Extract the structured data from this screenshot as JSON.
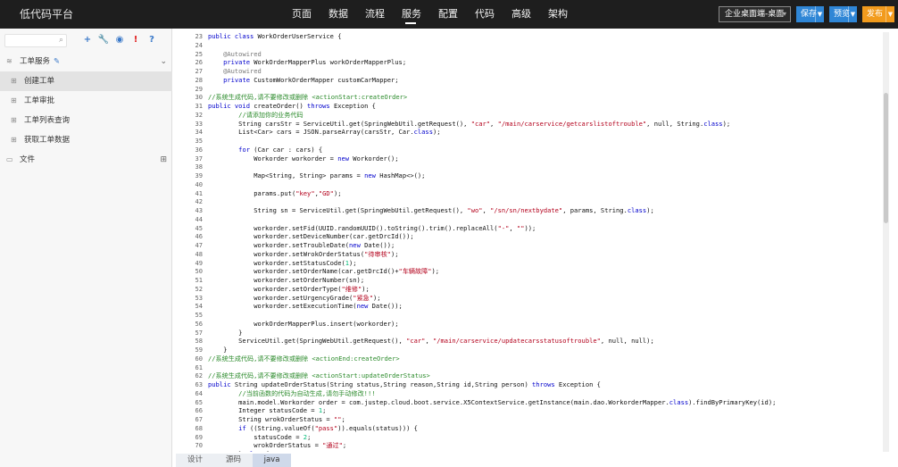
{
  "header": {
    "brand": "低代码平台",
    "nav": [
      "页面",
      "数据",
      "流程",
      "服务",
      "配置",
      "代码",
      "高级",
      "架构"
    ],
    "active_nav": 3,
    "app_select": "企业桌面端-桌面",
    "buttons": [
      {
        "label": "保存",
        "color": "#2f86d6"
      },
      {
        "label": "预览",
        "color": "#2f86d6"
      },
      {
        "label": "发布",
        "color": "#f29b1d"
      }
    ]
  },
  "sidebar": {
    "search_placeholder": "",
    "tools": [
      {
        "icon": "plus-icon",
        "glyph": "+",
        "color": "#3a79c9"
      },
      {
        "icon": "wrench-icon",
        "glyph": "🔧",
        "color": "#3a79c9"
      },
      {
        "icon": "globe-icon",
        "glyph": "◉",
        "color": "#3a79c9"
      },
      {
        "icon": "alert-icon",
        "glyph": "!",
        "color": "#e02020"
      },
      {
        "icon": "help-icon",
        "glyph": "?",
        "color": "#3a79c9"
      }
    ],
    "tree": [
      {
        "label": "工单服务",
        "icon": "layers-icon",
        "glyph": "≋",
        "edit_icon": "✎",
        "expanded": true,
        "children": [
          {
            "label": "创建工单",
            "selected": true
          },
          {
            "label": "工单审批"
          },
          {
            "label": "工单列表查询"
          },
          {
            "label": "获取工单数据"
          }
        ]
      },
      {
        "label": "文件",
        "icon": "folder-icon",
        "glyph": "▭"
      }
    ]
  },
  "editor": {
    "lines": [
      {
        "n": "23",
        "c": "<kw>public class</kw> WorkOrderUserService {"
      },
      {
        "n": "24",
        "c": ""
      },
      {
        "n": "25",
        "c": "    <an>@Autowired</an>"
      },
      {
        "n": "26",
        "c": "    <kw>private</kw> WorkOrderMapperPlus workOrderMapperPlus;"
      },
      {
        "n": "27",
        "c": "    <an>@Autowired</an>"
      },
      {
        "n": "28",
        "c": "    <kw>private</kw> CustomWorkOrderMapper customCarMapper;"
      },
      {
        "n": "29",
        "c": ""
      },
      {
        "n": "30",
        "c": "<cm>//系统生成代码,请不要修改或删除 <actionStart:createOrder></cm>"
      },
      {
        "n": "31",
        "c": "<kw>public void</kw> createOrder() <kw>throws</kw> Exception {"
      },
      {
        "n": "32",
        "c": "        <cm>//请添加你的业务代码</cm>"
      },
      {
        "n": "33",
        "c": "        String carsStr = ServiceUtil.get(SpringWebUtil.getRequest(), <str>\"car\"</str>, <str>\"/main/carservice/getcarslistoftrouble\"</str>, null, String.<kw>class</kw>);"
      },
      {
        "n": "34",
        "c": "        List<Car> cars = JSON.parseArray(carsStr, Car.<kw>class</kw>);"
      },
      {
        "n": "35",
        "c": ""
      },
      {
        "n": "36",
        "c": "        <kw>for</kw> (Car car : cars) {"
      },
      {
        "n": "37",
        "c": "            Workorder workorder = <kw>new</kw> Workorder();"
      },
      {
        "n": "38",
        "c": ""
      },
      {
        "n": "39",
        "c": "            Map<String, String> params = <kw>new</kw> HashMap<>();"
      },
      {
        "n": "40",
        "c": ""
      },
      {
        "n": "41",
        "c": "            params.put(<str>\"key\"</str>,<str>\"GD\"</str>);"
      },
      {
        "n": "42",
        "c": ""
      },
      {
        "n": "43",
        "c": "            String sn = ServiceUtil.get(SpringWebUtil.getRequest(), <str>\"wo\"</str>, <str>\"/sn/sn/nextbydate\"</str>, params, String.<kw>class</kw>);"
      },
      {
        "n": "44",
        "c": ""
      },
      {
        "n": "45",
        "c": "            workorder.setFid(UUID.randomUUID().toString().trim().replaceAll(<str>\"-\"</str>, <str>\"\"</str>));"
      },
      {
        "n": "46",
        "c": "            workorder.setDeviceNumber(car.getDrcId());"
      },
      {
        "n": "47",
        "c": "            workorder.setTroubleDate(<kw>new</kw> Date());"
      },
      {
        "n": "48",
        "c": "            workorder.setWrokOrderStatus(<str>\"待审核\"</str>);"
      },
      {
        "n": "49",
        "c": "            workorder.setStatusCode(<num>1</num>);"
      },
      {
        "n": "50",
        "c": "            workorder.setOrderName(car.getDrcId()+<str>\"车辆故障\"</str>);"
      },
      {
        "n": "51",
        "c": "            workorder.setOrderNumber(sn);"
      },
      {
        "n": "52",
        "c": "            workorder.setOrderType(<str>\"维修\"</str>);"
      },
      {
        "n": "53",
        "c": "            workorder.setUrgencyGrade(<str>\"紧急\"</str>);"
      },
      {
        "n": "54",
        "c": "            workorder.setExecutionTime(<kw>new</kw> Date());"
      },
      {
        "n": "55",
        "c": ""
      },
      {
        "n": "56",
        "c": "            workOrderMapperPlus.insert(workorder);"
      },
      {
        "n": "57",
        "c": "        }"
      },
      {
        "n": "58",
        "c": "        ServiceUtil.get(SpringWebUtil.getRequest(), <str>\"car\"</str>, <str>\"/main/carservice/updatecarsstatusoftrouble\"</str>, null, null);"
      },
      {
        "n": "59",
        "c": "    }"
      },
      {
        "n": "60",
        "c": "<cm>//系统生成代码,请不要修改或删除 <actionEnd:createOrder></cm>"
      },
      {
        "n": "61",
        "c": ""
      },
      {
        "n": "62",
        "c": "<cm>//系统生成代码,请不要修改或删除 <actionStart:updateOrderStatus></cm>"
      },
      {
        "n": "63",
        "c": "<kw>public</kw> String updateOrderStatus(String status,String reason,String id,String person) <kw>throws</kw> Exception {"
      },
      {
        "n": "64",
        "c": "        <cm>//当前函数的代码为自动生成,请勿手动修改!!!</cm>"
      },
      {
        "n": "65",
        "c": "        main.model.Workorder order = com.justep.cloud.boot.service.X5ContextService.getInstance(main.dao.WorkorderMapper.<kw>class</kw>).findByPrimaryKey(id);"
      },
      {
        "n": "66",
        "c": "        Integer statusCode = <num>1</num>;"
      },
      {
        "n": "67",
        "c": "        String wrokOrderStatus = <str>\"\"</str>;"
      },
      {
        "n": "68",
        "c": "        <kw>if</kw> ((String.valueOf(<str>\"pass\"</str>)).equals(status))) {"
      },
      {
        "n": "69",
        "c": "            statusCode = <num>2</num>;"
      },
      {
        "n": "70",
        "c": "            wrokOrderStatus = <str>\"通过\"</str>;"
      },
      {
        "n": "71",
        "c": "        } <kw>else</kw> {"
      }
    ]
  },
  "bottom_tabs": [
    {
      "label": "设计"
    },
    {
      "label": "源码"
    },
    {
      "label": "java",
      "active": true
    }
  ]
}
